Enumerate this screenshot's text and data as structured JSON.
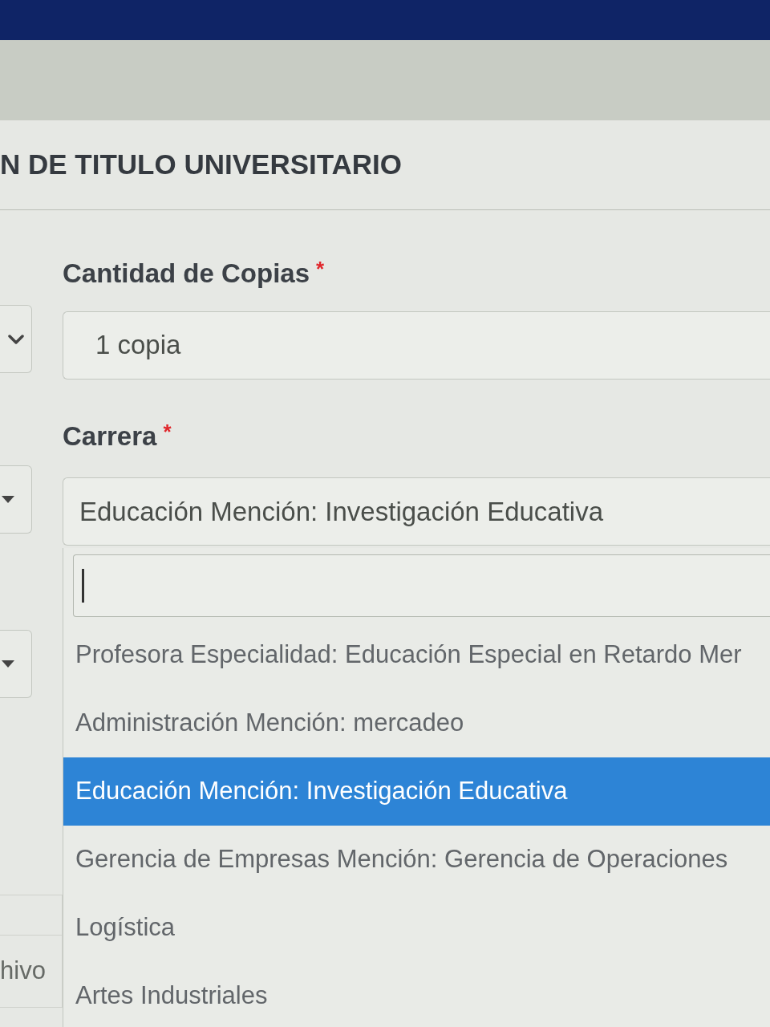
{
  "page_title": "N DE TITULO UNIVERSITARIO",
  "left_column": {
    "fields": [
      {
        "kind": "chevron"
      },
      {
        "kind": "caret"
      },
      {
        "kind": "caret"
      }
    ],
    "cell": "hivo"
  },
  "form": {
    "fields": [
      {
        "label": "Cantidad de Copias",
        "required_mark": "*",
        "value": "1 copia"
      },
      {
        "label": "Carrera",
        "required_mark": "*",
        "value": "Educación Mención: Investigación Educativa",
        "dropdown": {
          "search": {
            "focused": true
          },
          "options": [
            {
              "label": "Profesora Especialidad: Educación Especial en Retardo Mer",
              "selected": false
            },
            {
              "label": "Administración Mención: mercadeo",
              "selected": false
            },
            {
              "label": "Educación Mención: Investigación Educativa",
              "selected": true
            },
            {
              "label": "Gerencia de Empresas Mención: Gerencia de Operaciones",
              "selected": false
            },
            {
              "label": "Logística",
              "selected": false
            },
            {
              "label": "Artes Industriales",
              "selected": false
            }
          ]
        }
      }
    ]
  }
}
